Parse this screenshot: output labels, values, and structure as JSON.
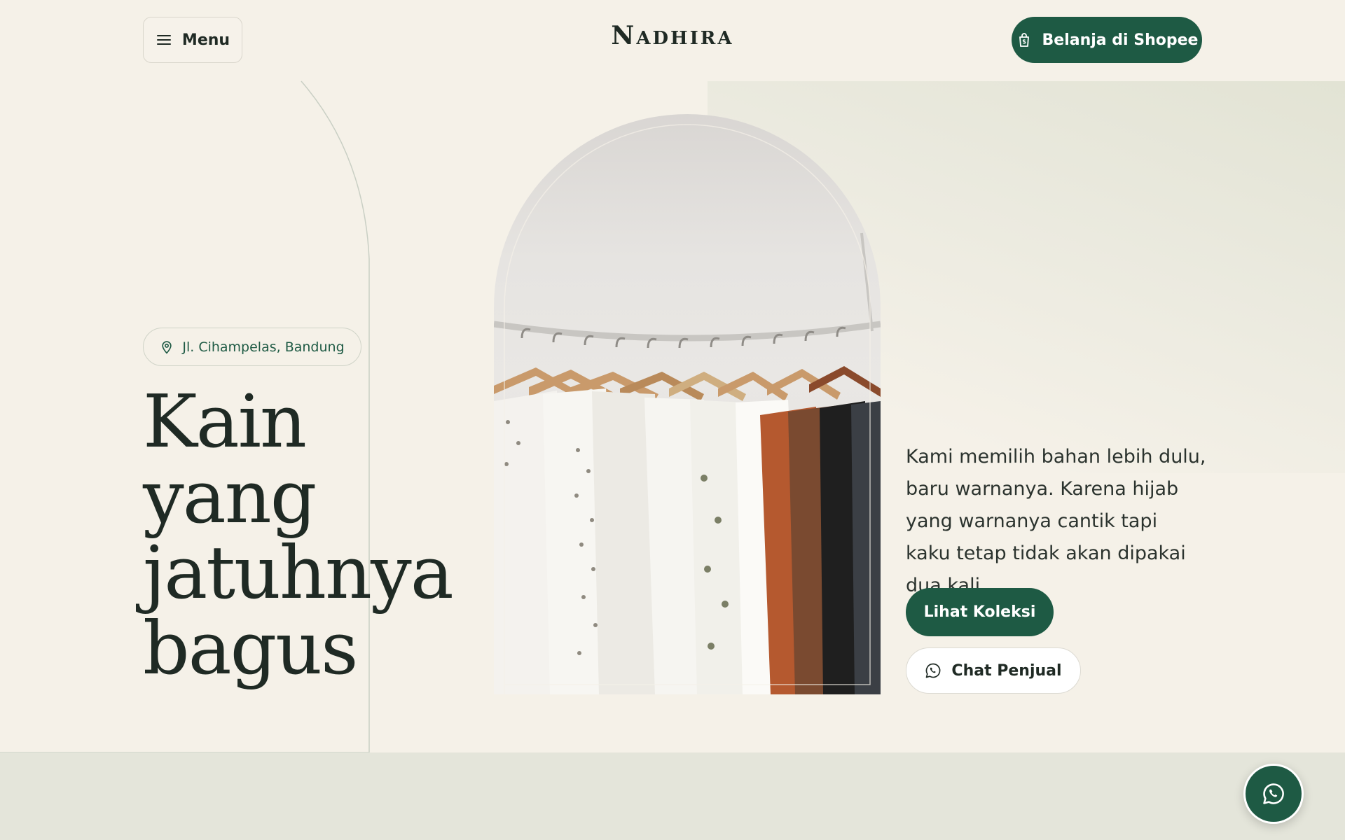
{
  "header": {
    "menu_label": "Menu",
    "logo_first": "N",
    "logo_rest": "ADHIRA",
    "shop_label": "Belanja di Shopee"
  },
  "hero": {
    "location": "Jl. Cihampelas, Bandung",
    "headline": [
      "Kain",
      "yang",
      "jatuhnya",
      "bagus"
    ],
    "description": "Kami memilih bahan lebih dulu, baru warnanya. Karena hijab yang warnanya cantik tapi kaku tetap tidak akan dipakai dua kali.",
    "primary_cta": "Lihat Koleksi",
    "secondary_cta": "Chat Penjual"
  },
  "icons": {
    "menu": "hamburger-icon",
    "shop": "shopping-bag-icon",
    "location": "map-pin-icon",
    "chat": "whatsapp-icon",
    "fab": "whatsapp-icon"
  },
  "colors": {
    "background": "#f5f1e8",
    "brand_green": "#1e5a44",
    "text_dark": "#1f2a24",
    "band": "#e4e5da"
  }
}
